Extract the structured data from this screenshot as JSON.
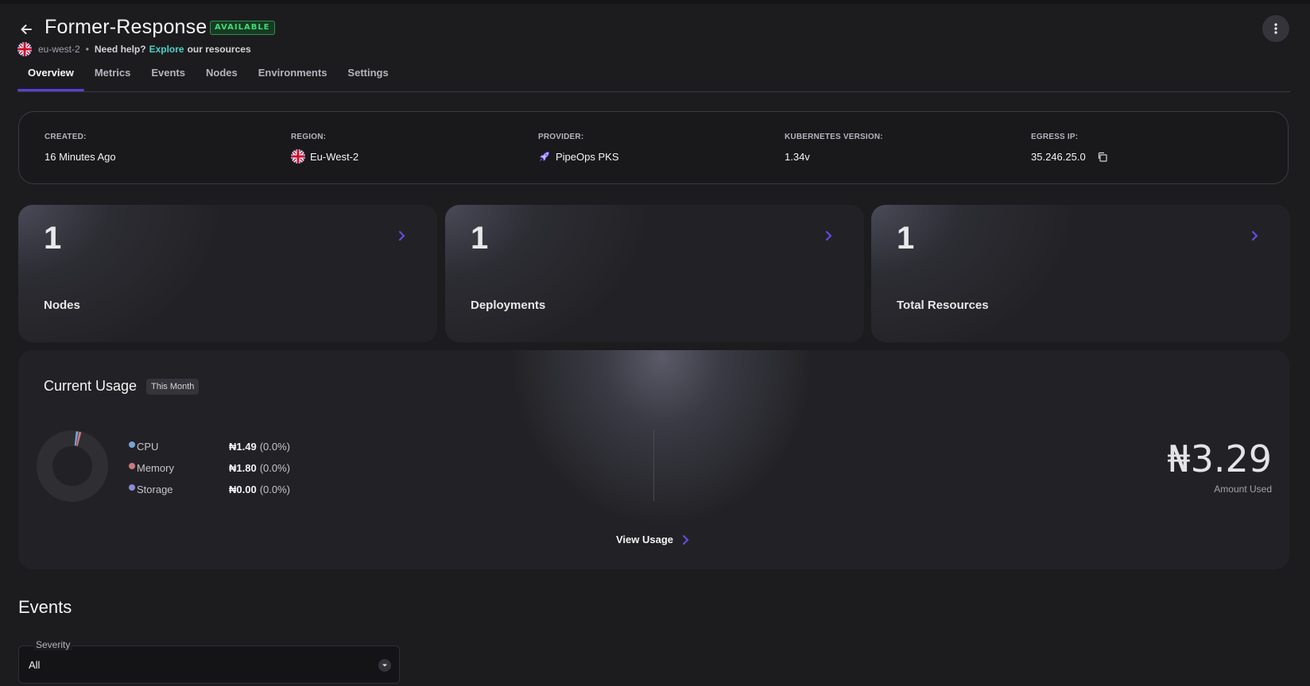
{
  "header": {
    "title": "Former-Response",
    "status_badge": "AVAILABLE",
    "region_code": "eu-west-2",
    "separator": "•",
    "help_text": "Need help?",
    "help_link": "Explore",
    "help_rest": "our resources"
  },
  "tabs": [
    {
      "label": "Overview",
      "active": true
    },
    {
      "label": "Metrics"
    },
    {
      "label": "Events"
    },
    {
      "label": "Nodes"
    },
    {
      "label": "Environments"
    },
    {
      "label": "Settings"
    }
  ],
  "info": {
    "created": {
      "label": "CREATED:",
      "value": "16 Minutes Ago"
    },
    "region": {
      "label": "REGION:",
      "value": "Eu-West-2"
    },
    "provider": {
      "label": "PROVIDER:",
      "value": "PipeOps PKS"
    },
    "k8s": {
      "label": "KUBERNETES VERSION:",
      "value": "1.34v"
    },
    "egress": {
      "label": "EGRESS IP:",
      "value": "35.246.25.0"
    }
  },
  "stats": [
    {
      "value": "1",
      "label": "Nodes"
    },
    {
      "value": "1",
      "label": "Deployments"
    },
    {
      "value": "1",
      "label": "Total Resources"
    }
  ],
  "usage": {
    "title": "Current Usage",
    "period": "This Month",
    "items": [
      {
        "name": "CPU",
        "amount": "₦1.49",
        "pct": "(0.0%)",
        "color": "#7aa2d6",
        "value": 1.49
      },
      {
        "name": "Memory",
        "amount": "₦1.80",
        "pct": "(0.0%)",
        "color": "#c97a7a",
        "value": 1.8
      },
      {
        "name": "Storage",
        "amount": "₦0.00",
        "pct": "(0.0%)",
        "color": "#8b8bd6",
        "value": 0.0
      }
    ],
    "total": "₦3.29",
    "total_label": "Amount Used",
    "view_label": "View Usage"
  },
  "events": {
    "title": "Events",
    "severity_label": "Severity",
    "severity_value": "All"
  },
  "colors": {
    "accent": "#5b3fd6",
    "status_green": "#3ddc74",
    "link": "#4fd1c5"
  }
}
